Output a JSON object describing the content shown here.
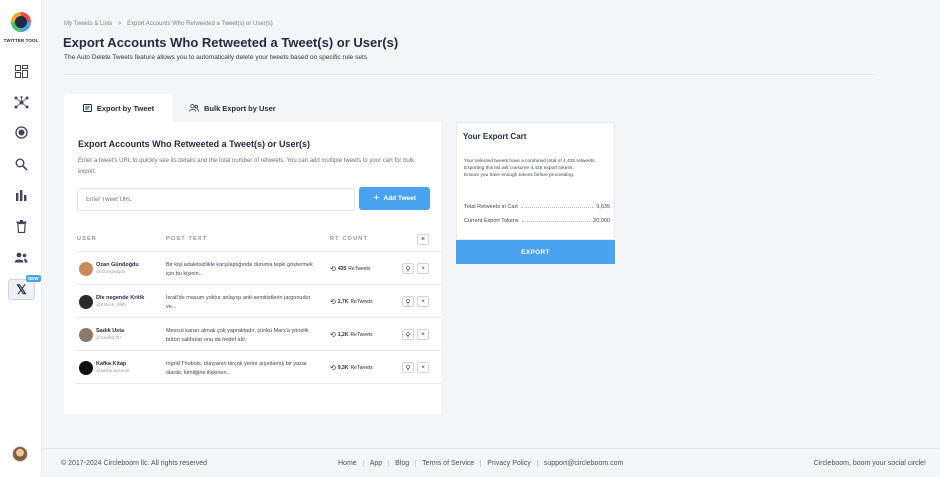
{
  "sidebar": {
    "logo_text": "TWITTER TOOL",
    "items": [
      {
        "icon": "dashboard-icon"
      },
      {
        "icon": "network-icon"
      },
      {
        "icon": "circle-target-icon"
      },
      {
        "icon": "search-icon"
      },
      {
        "icon": "bar-chart-icon"
      },
      {
        "icon": "trash-icon"
      },
      {
        "icon": "users-icon"
      },
      {
        "icon": "x-logo-icon",
        "label": "𝕏"
      }
    ],
    "new_badge": "NEW"
  },
  "breadcrumb": {
    "items": [
      "My Tweets & Lists",
      ">",
      "Export Accounts Who Retweeted a Tweet(s) or User(s)"
    ]
  },
  "header": {
    "title": "Export Accounts Who Retweeted a Tweet(s) or User(s)",
    "subtitle": "The Auto Delete Tweets feature allows you to automatically delete your tweets based on specific rule sets"
  },
  "tabs": [
    {
      "label": "Export by Tweet",
      "active": true
    },
    {
      "label": "Bulk Export by User",
      "active": false
    }
  ],
  "main": {
    "title": "Export Accounts Who Retweeted a Tweet(s) or User(s)",
    "description": "Enter a tweet's URL to quickly see its details and the total number of retweets. You can add multiple tweets to your cart for bulk export.",
    "input_placeholder": "Enter Tweet URL",
    "add_button": "Add Tweet",
    "add_plus": "+",
    "columns": {
      "user": "USER",
      "post": "POST TEXT",
      "rt": "RT COUNT"
    },
    "clear_all": "×",
    "rows": [
      {
        "name": "Ozan Gündoğdu",
        "handle": "@ozangndgdu",
        "text": "Bir kişi adaletsizlikle karşılaştığında duruma tepki göstermek için bu kişinin...",
        "rt_count": "435",
        "rt_suffix": "ReTweets",
        "avatar_color": "#c98b5e"
      },
      {
        "name": "Dle negende Kritik",
        "handle": "@Kritsch_99th",
        "text": "İsrail'de masum yoktur anlayışı anti-semitistlerin jargonudur ve...",
        "rt_count": "2,7K",
        "rt_suffix": "ReTweets",
        "avatar_color": "#2a2a2a"
      },
      {
        "name": "Sadık Usta",
        "handle": "@Sadkst757",
        "text": "Mevcut kararı almak çok yapraktadır, çünkü Marx'a yönelik bütün saldırılar onu da hedef alır.",
        "rt_count": "1,2K",
        "rt_suffix": "ReTweets",
        "avatar_color": "#8b7a6a"
      },
      {
        "name": "Kafka Kitap",
        "handle": "@kafkacaysmail",
        "text": "Ingrid Thobois, dünyanın birçok yerini arşınlamış bir yazar olarak, kimliğine ilişkinen...",
        "rt_count": "9,3K",
        "rt_suffix": "ReTweets",
        "avatar_color": "#111111"
      }
    ],
    "link_icon": "⚲",
    "delete_icon": "×",
    "rt_icon": "⟲"
  },
  "cart": {
    "title": "Your Export Cart",
    "description_1": "Your selected tweets have a combined total of 4,435 retweets. Exporting this list will consume 4,435 export tokens.",
    "description_2": "Ensure you have enough tokens before proceeding.",
    "total_label": "Total Retweets in Cart",
    "total_value": "9,635",
    "tokens_label": "Current Export Tokens",
    "tokens_value": "20,000",
    "export_button": "EXPORT"
  },
  "footer": {
    "copyright": "© 2017-2024 Circleboom llc. All rights reserved",
    "links": [
      "Home",
      "App",
      "Blog",
      "Terms of Service",
      "Privacy Policy",
      "support@circleboom.com"
    ],
    "tagline": "Circleboom, boom your social circle!"
  },
  "colors": {
    "accent": "#4aa3f0",
    "title": "#1f2a44",
    "background": "#f4f5f7"
  }
}
